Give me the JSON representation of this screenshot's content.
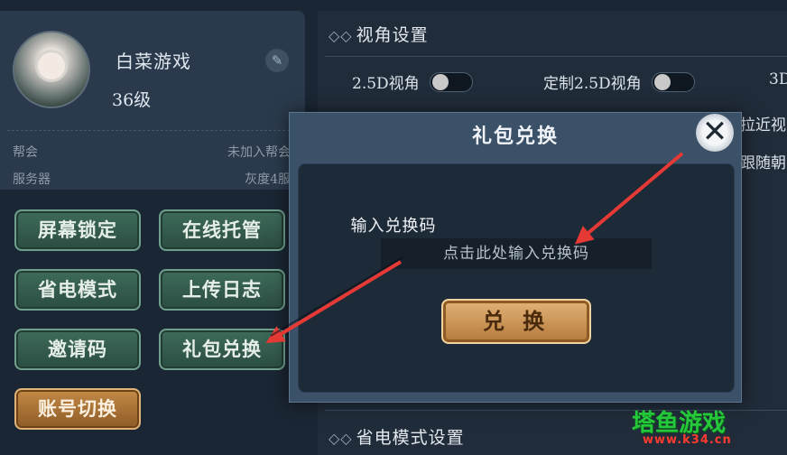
{
  "profile": {
    "name": "白菜游戏",
    "level": "36级",
    "guild_label": "帮会",
    "guild_value": "未加入帮会",
    "server_label": "服务器",
    "server_value": "灰度4服"
  },
  "left_buttons": {
    "screen_lock": "屏幕锁定",
    "online_host": "在线托管",
    "power_save": "省电模式",
    "upload_log": "上传日志",
    "invite_code": "邀请码",
    "gift_redeem": "礼包兑换",
    "switch_account": "账号切换"
  },
  "settings": {
    "view_title": "视角设置",
    "opt_25d": "2.5D视角",
    "opt_custom_25d": "定制2.5D视角",
    "opt_3d_partial": "3D",
    "partial_close_view": "拉近视",
    "partial_follow": "跟随朝",
    "power_title": "省电模式设置"
  },
  "dialog": {
    "title": "礼包兑换",
    "code_label": "输入兑换码",
    "code_placeholder": "点击此处输入兑换码",
    "code_value": "",
    "redeem_button": "兑 换",
    "close_icon": "✕"
  },
  "watermark": {
    "name": "塔鱼游戏",
    "url": "www.k34.cn"
  },
  "colors": {
    "green_button": "#3e6b5a",
    "gold_button": "#c38a46",
    "arrow_red": "#e53935",
    "watermark_green": "#25c83a"
  }
}
